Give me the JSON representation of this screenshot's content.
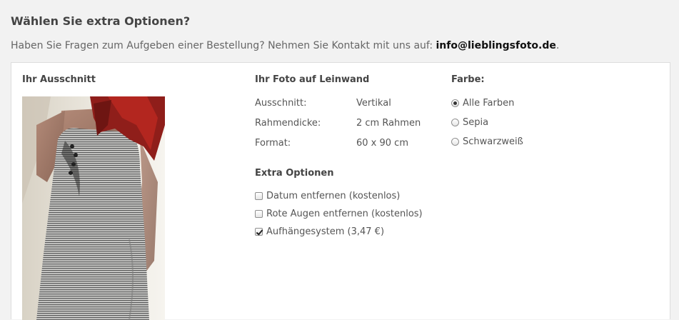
{
  "header": {
    "title": "Wählen Sie extra Optionen?",
    "intro_text": "Haben Sie Fragen zum Aufgeben einer Bestellung? Nehmen Sie Kontakt mit uns auf: ",
    "email": "info@lieblingsfoto.de",
    "intro_end": "."
  },
  "crop": {
    "title": "Ihr Ausschnitt"
  },
  "photo_details": {
    "title": "Ihr Foto auf Leinwand",
    "rows": [
      {
        "label": "Ausschnitt:",
        "value": "Vertikal"
      },
      {
        "label": "Rahmendicke:",
        "value": "2 cm Rahmen"
      },
      {
        "label": "Format:",
        "value": "60 x 90 cm"
      }
    ]
  },
  "color": {
    "title": "Farbe:",
    "options": [
      {
        "label": "Alle Farben",
        "checked": true
      },
      {
        "label": "Sepia",
        "checked": false
      },
      {
        "label": "Schwarzweiß",
        "checked": false
      }
    ]
  },
  "extras": {
    "title": "Extra Optionen",
    "options": [
      {
        "label": "Datum entfernen (kostenlos)",
        "checked": false
      },
      {
        "label": "Rote Augen entfernen (kostenlos)",
        "checked": false
      },
      {
        "label": "Aufhängesystem (3,47 €)",
        "checked": true
      }
    ]
  },
  "colors": {
    "background": "#f2f2f2",
    "panel": "#ffffff",
    "text": "#555555",
    "heading": "#444444",
    "email": "#111111"
  }
}
